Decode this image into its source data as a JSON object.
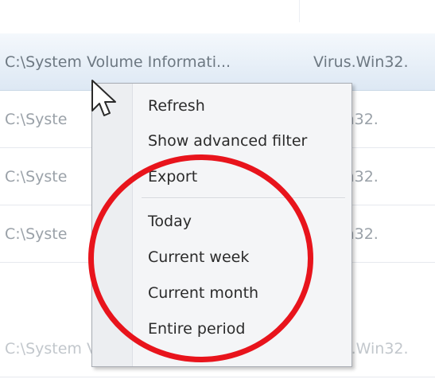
{
  "table": {
    "rows": [
      {
        "path": "C:\\System Volume Informati...",
        "threat": "Virus.Win32."
      },
      {
        "path": "C:\\Syste",
        "threat": "s.Win32."
      },
      {
        "path": "C:\\Syste",
        "threat": "s.Win32."
      },
      {
        "path": "C:\\Syste",
        "threat": "s.Win32."
      },
      {
        "path": "C:\\System Volume Informati...",
        "threat": "Virus.Win32."
      }
    ]
  },
  "context_menu": {
    "items": [
      "Refresh",
      "Show advanced filter",
      "Export",
      "Today",
      "Current week",
      "Current month",
      "Entire period"
    ]
  },
  "colors": {
    "annotation_circle": "#e8141c",
    "selection_highlight": "#dde8f4"
  },
  "icons": {
    "cursor": "mouse-pointer-icon"
  }
}
